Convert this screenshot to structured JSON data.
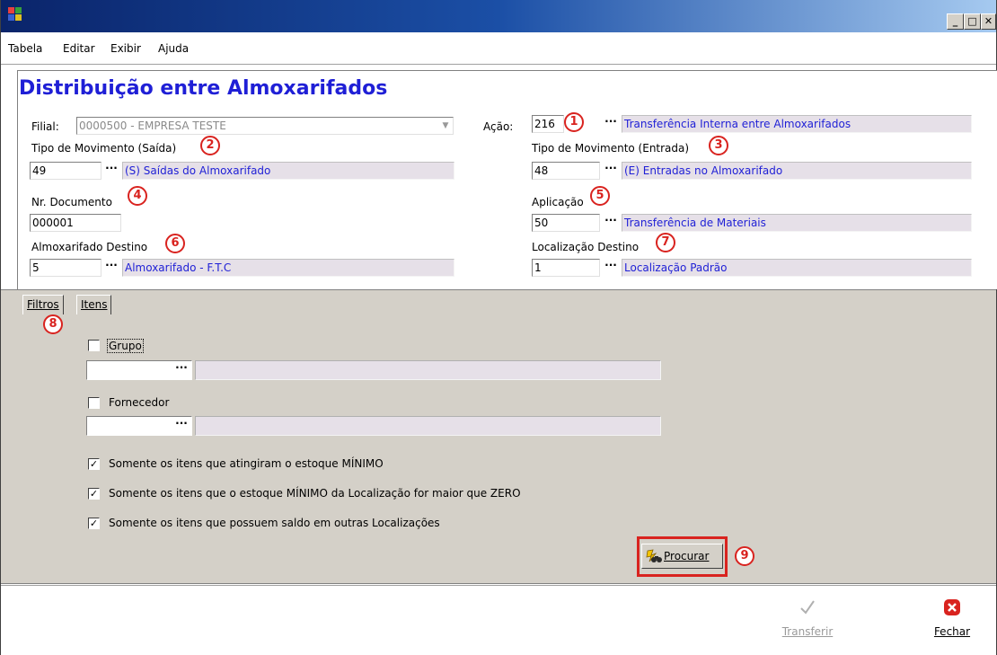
{
  "window": {
    "title": ""
  },
  "menu": [
    "Tabela",
    "Editar",
    "Exibir",
    "Ajuda"
  ],
  "page_title": "Distribuição entre Almoxarifados",
  "fields": {
    "filial": {
      "label": "Filial:",
      "value": "0000500 - EMPRESA TESTE"
    },
    "acao": {
      "label": "Ação:",
      "code": "216",
      "description": "Transferência Interna entre Almoxarifados"
    },
    "tipo_mov_saida": {
      "label": "Tipo de Movimento (Saída)",
      "code": "49",
      "description": "(S) Saídas do Almoxarifado"
    },
    "tipo_mov_entrada": {
      "label": "Tipo de Movimento (Entrada)",
      "code": "48",
      "description": "(E) Entradas no Almoxarifado"
    },
    "nr_documento": {
      "label": "Nr. Documento",
      "value": "000001"
    },
    "aplicacao": {
      "label": "Aplicação",
      "code": "50",
      "description": "Transferência de Materiais"
    },
    "almox_destino": {
      "label": "Almoxarifado Destino",
      "code": "5",
      "description": "Almoxarifado - F.T.C"
    },
    "localizacao_destino": {
      "label": "Localização Destino",
      "code": "1",
      "description": "Localização Padrão"
    }
  },
  "badges": [
    "1",
    "2",
    "3",
    "4",
    "5",
    "6",
    "7",
    "8",
    "9"
  ],
  "tabs": [
    {
      "label": "Filtros",
      "active": true
    },
    {
      "label": "Itens",
      "active": false
    }
  ],
  "filters": {
    "grupo": {
      "label": "Grupo",
      "checked": false
    },
    "fornecedor": {
      "label": "Fornecedor",
      "checked": false
    },
    "options": [
      {
        "label": "Somente os itens que atingiram o estoque MÍNIMO",
        "checked": true
      },
      {
        "label": "Somente os itens que o estoque MÍNIMO da Localização for maior que ZERO",
        "checked": true
      },
      {
        "label": "Somente os itens que possuem saldo em outras Localizações",
        "checked": true
      }
    ],
    "search_button": "Procurar"
  },
  "footer": {
    "transferir": "Transferir",
    "fechar": "Fechar"
  },
  "colors": {
    "accent": "#1f1fd6",
    "highlight": "#d9231f",
    "panel": "#d4d0c8"
  },
  "ellipsis": "···",
  "checkmark": "✓",
  "icons": {
    "app": "app-icon",
    "minimize": "minimize-icon",
    "maximize": "maximize-icon",
    "close": "close-icon",
    "search": "binoculars-icon",
    "transfer": "checkmark-icon",
    "exit": "close-x-icon"
  }
}
